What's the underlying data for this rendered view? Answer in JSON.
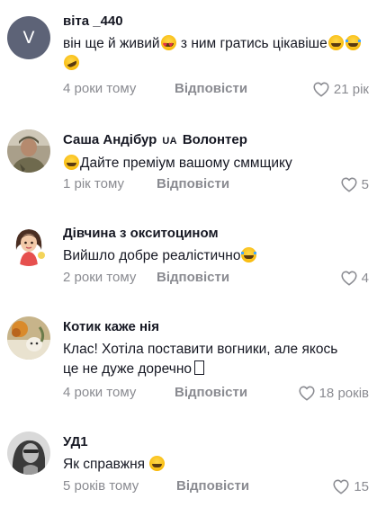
{
  "comments": [
    {
      "username": "віта _440",
      "avatar_letter": "V",
      "text_parts": [
        "він ще й живий",
        " з ним гратись цікавіше"
      ],
      "time": "4 роки тому",
      "reply_label": "Відповісти",
      "likes": "21 рік"
    },
    {
      "username": "Саша Андібур",
      "flag": "UA",
      "username_suffix": "Волонтер",
      "text": "Дайте преміум вашому смм​щику",
      "time": "1 рік тому",
      "reply_label": "Відповісти",
      "likes": "5"
    },
    {
      "username": "Дівчина з окситоцином",
      "text": "Вийшло добре реалістично",
      "time": "2 роки тому",
      "reply_label": "Відповісти",
      "likes": "4"
    },
    {
      "username": "Котик каже нія",
      "text": "Клас! Хотіла поставити вогники, але якось це не дуже доречно",
      "time": "4 роки тому",
      "reply_label": "Відповісти",
      "likes": "18 років"
    },
    {
      "username": "УД1",
      "text": "Як справжня",
      "time": "5 років тому",
      "reply_label": "Відповісти",
      "likes": "15"
    }
  ],
  "icons": {
    "like": "heart-outline-icon",
    "emoji_hearts": "smiling-face-with-heart-eyes",
    "emoji_grin": "grinning-squinting-face",
    "emoji_joy": "face-with-tears-of-joy",
    "emoji_rofl": "rolling-on-the-floor-laughing",
    "missing_glyph": "missing-glyph-box"
  },
  "colors": {
    "text": "#161823",
    "meta": "#8a8b91",
    "avatar_letter_bg": "#5d6377"
  }
}
